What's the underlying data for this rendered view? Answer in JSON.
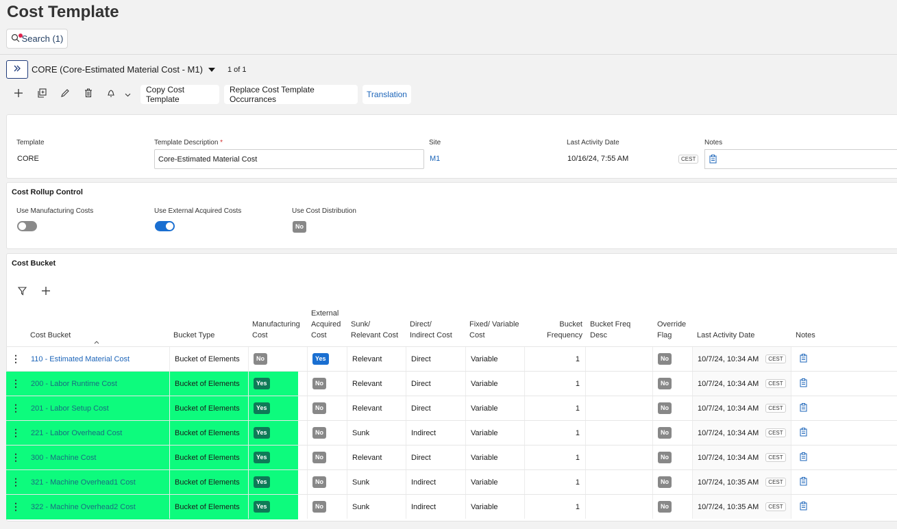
{
  "page": {
    "title": "Cost Template"
  },
  "search": {
    "label": "Search (1)"
  },
  "record": {
    "selector": "CORE (Core-Estimated Material Cost - M1)",
    "count": "1 of 1"
  },
  "toolbar": {
    "copy_label": "Copy Cost Template",
    "replace_label": "Replace Cost Template Occurrances",
    "translation_label": "Translation"
  },
  "header": {
    "template_label": "Template",
    "template_value": "CORE",
    "description_label": "Template Description",
    "required_mark": "*",
    "description_value": "Core-Estimated Material Cost",
    "site_label": "Site",
    "site_value": "M1",
    "last_activity_label": "Last Activity Date",
    "last_activity_value": "10/16/24, 7:55 AM",
    "tz": "CEST",
    "notes_label": "Notes"
  },
  "rollup": {
    "title": "Cost Rollup Control",
    "use_manufacturing_label": "Use Manufacturing Costs",
    "use_manufacturing_on": false,
    "use_external_label": "Use External Acquired Costs",
    "use_external_on": true,
    "use_distribution_label": "Use Cost Distribution",
    "use_distribution_value": "No"
  },
  "bucket_section": {
    "title": "Cost Bucket"
  },
  "columns": {
    "cost_bucket": "Cost Bucket",
    "bucket_type": "Bucket Type",
    "manufacturing": [
      "Manufacturing",
      "Cost"
    ],
    "external": [
      "External",
      "Acquired",
      "Cost"
    ],
    "sunk": [
      "Sunk/",
      "Relevant Cost"
    ],
    "direct": [
      "Direct/",
      "Indirect Cost"
    ],
    "fixed": [
      "Fixed/ Variable",
      "Cost"
    ],
    "frequency": [
      "Bucket",
      "Frequency"
    ],
    "freq_desc": [
      "Bucket Freq",
      "Desc"
    ],
    "override": [
      "Override",
      "Flag"
    ],
    "last_activity": "Last Activity Date",
    "notes": "Notes"
  },
  "rows": [
    {
      "bucket": "110 - Estimated Material Cost",
      "type": "Bucket of Elements",
      "mfg": "No",
      "ext": "Yes",
      "sunk": "Relevant",
      "direct": "Direct",
      "fixed": "Variable",
      "freq": "1",
      "override": "No",
      "date": "10/7/24, 10:34 AM",
      "tz": "CEST",
      "highlight": false
    },
    {
      "bucket": "200 - Labor Runtime Cost",
      "type": "Bucket of Elements",
      "mfg": "Yes",
      "ext": "No",
      "sunk": "Relevant",
      "direct": "Direct",
      "fixed": "Variable",
      "freq": "1",
      "override": "No",
      "date": "10/7/24, 10:34 AM",
      "tz": "CEST",
      "highlight": true
    },
    {
      "bucket": "201 - Labor Setup Cost",
      "type": "Bucket of Elements",
      "mfg": "Yes",
      "ext": "No",
      "sunk": "Relevant",
      "direct": "Direct",
      "fixed": "Variable",
      "freq": "1",
      "override": "No",
      "date": "10/7/24, 10:34 AM",
      "tz": "CEST",
      "highlight": true
    },
    {
      "bucket": "221 - Labor Overhead Cost",
      "type": "Bucket of Elements",
      "mfg": "Yes",
      "ext": "No",
      "sunk": "Sunk",
      "direct": "Indirect",
      "fixed": "Variable",
      "freq": "1",
      "override": "No",
      "date": "10/7/24, 10:34 AM",
      "tz": "CEST",
      "highlight": true
    },
    {
      "bucket": "300 - Machine Cost",
      "type": "Bucket of Elements",
      "mfg": "Yes",
      "ext": "No",
      "sunk": "Relevant",
      "direct": "Direct",
      "fixed": "Variable",
      "freq": "1",
      "override": "No",
      "date": "10/7/24, 10:34 AM",
      "tz": "CEST",
      "highlight": true
    },
    {
      "bucket": "321 - Machine Overhead1 Cost",
      "type": "Bucket of Elements",
      "mfg": "Yes",
      "ext": "No",
      "sunk": "Sunk",
      "direct": "Indirect",
      "fixed": "Variable",
      "freq": "1",
      "override": "No",
      "date": "10/7/24, 10:35 AM",
      "tz": "CEST",
      "highlight": true
    },
    {
      "bucket": "322 - Machine Overhead2 Cost",
      "type": "Bucket of Elements",
      "mfg": "Yes",
      "ext": "No",
      "sunk": "Sunk",
      "direct": "Indirect",
      "fixed": "Variable",
      "freq": "1",
      "override": "No",
      "date": "10/7/24, 10:35 AM",
      "tz": "CEST",
      "highlight": true
    }
  ],
  "colors": {
    "highlight": "#0dfb7d",
    "link": "#1a63b8",
    "toggle_on": "#1a6fd1",
    "yes_badge": "#0e7a57",
    "no_badge": "#888888"
  }
}
